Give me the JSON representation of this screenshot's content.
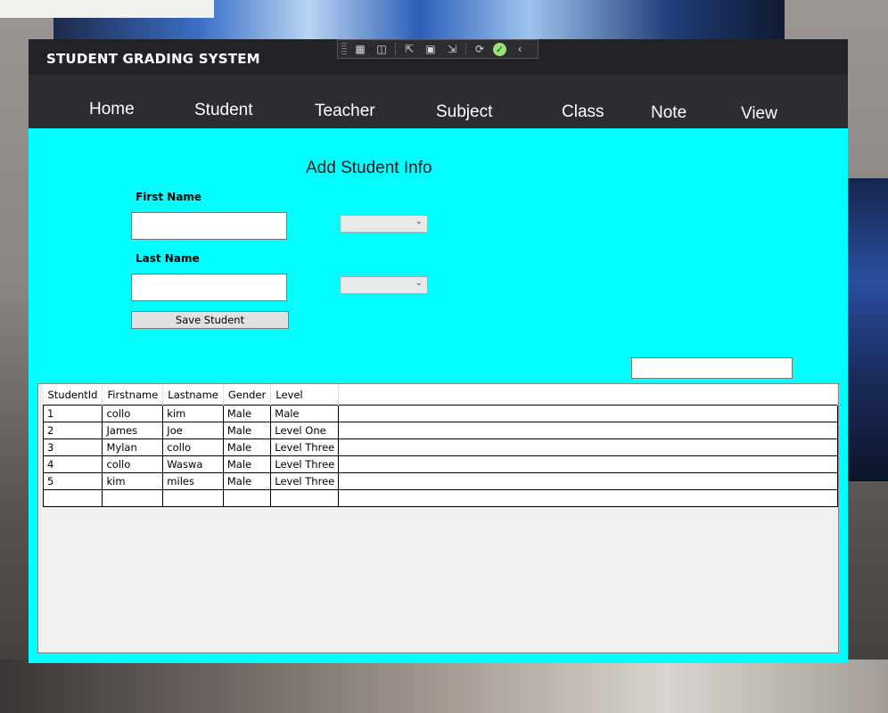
{
  "app": {
    "title": "STUDENT GRADING SYSTEM"
  },
  "toolbar": {
    "icons": [
      "live-visual-tree-icon",
      "record-icon",
      "select-element-icon",
      "display-layout-adorners-icon",
      "track-focus-icon",
      "hot-reload-icon",
      "check-icon",
      "collapse-icon"
    ]
  },
  "nav": {
    "items": [
      "Home",
      "Student",
      "Teacher",
      "Subject",
      "Class",
      "Note",
      "View"
    ]
  },
  "form": {
    "title": "Add Student Info",
    "first_name_label": "First Name",
    "last_name_label": "Last Name",
    "first_name_value": "",
    "last_name_value": "",
    "combo1_value": "",
    "combo2_value": "",
    "save_label": "Save Student"
  },
  "search": {
    "value": ""
  },
  "table": {
    "columns": [
      "StudentId",
      "Firstname",
      "Lastname",
      "Gender",
      "Level"
    ],
    "rows": [
      [
        "1",
        "collo",
        "kim",
        "Male",
        "Male"
      ],
      [
        "2",
        "James",
        "Joe",
        "Male",
        "Level One"
      ],
      [
        "3",
        "Mylan",
        "collo",
        "Male",
        "Level Three"
      ],
      [
        "4",
        "collo",
        "Waswa",
        "Male",
        "Level Three"
      ],
      [
        "5",
        "kim",
        "miles",
        "Male",
        "Level Three"
      ],
      [
        "",
        "",
        "",
        "",
        ""
      ]
    ]
  },
  "colors": {
    "content_bg": "#00ffff",
    "titlebar_bg": "#212327",
    "navbar_bg": "#2b2d33"
  }
}
